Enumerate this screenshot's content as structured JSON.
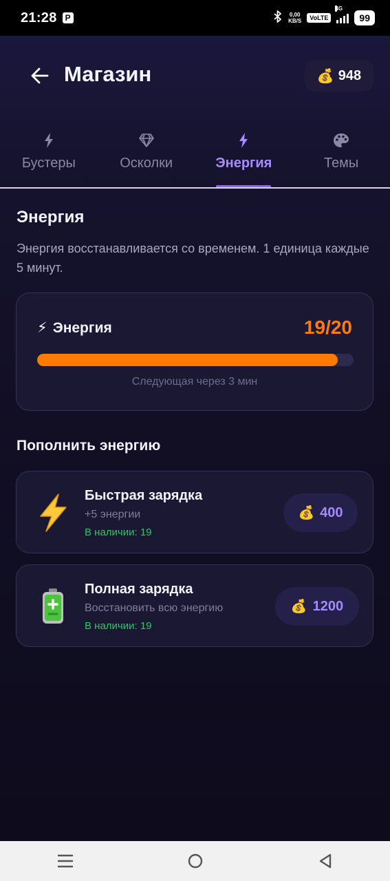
{
  "status_bar": {
    "time": "21:28",
    "net_speed_value": "0,00",
    "net_speed_unit": "KB/S",
    "volte": "VoLTE",
    "network": "4G",
    "battery": "99"
  },
  "header": {
    "title": "Магазин",
    "coins": "948"
  },
  "tabs": [
    {
      "label": "Бустеры",
      "icon": "bolt-icon",
      "active": false
    },
    {
      "label": "Осколки",
      "icon": "gem-icon",
      "active": false
    },
    {
      "label": "Энергия",
      "icon": "lightning-icon",
      "active": true
    },
    {
      "label": "Темы",
      "icon": "palette-icon",
      "active": false
    }
  ],
  "section": {
    "title": "Энергия",
    "description": "Энергия восстанавливается со временем. 1 единица каждые 5 минут."
  },
  "energy": {
    "icon": "⚡",
    "label": "Энергия",
    "display": "19/20",
    "current": 19,
    "max": 20,
    "next_text": "Следующая через 3 мин"
  },
  "refill": {
    "title": "Пополнить энергию",
    "offers": [
      {
        "icon": "⚡",
        "name": "Быстрая зарядка",
        "subtitle": "+5 энергии",
        "stock": "В наличии: 19",
        "price_icon": "💰",
        "price": "400"
      },
      {
        "icon": "🔋",
        "name": "Полная зарядка",
        "subtitle": "Восстановить всю энергию",
        "stock": "В наличии: 19",
        "price_icon": "💰",
        "price": "1200"
      }
    ]
  },
  "colors": {
    "accent": "#8a63ff",
    "energy": "#ff7a00",
    "stock": "#35c267"
  }
}
